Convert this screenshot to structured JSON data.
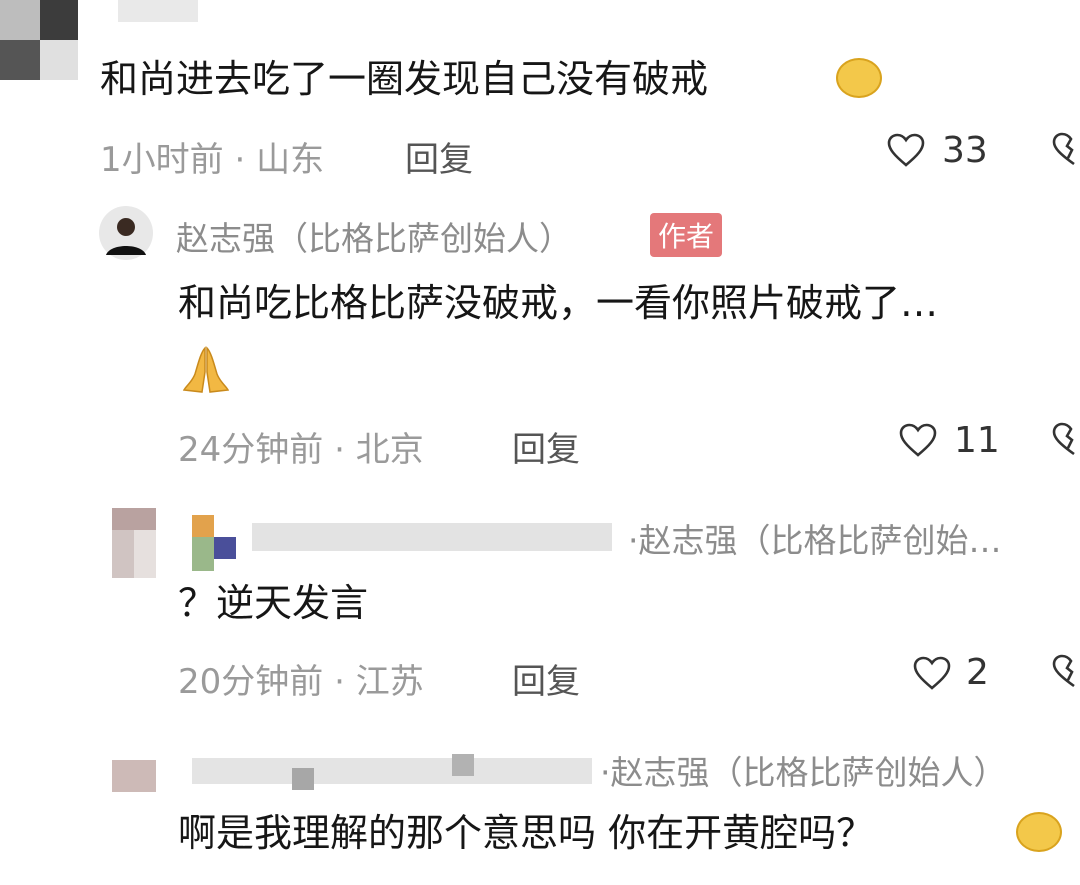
{
  "comments": [
    {
      "text": "和尚进去吃了一圈发现自己没有破戒",
      "emoji": "laughing-crying-emoji",
      "time": "1小时前",
      "location": "山东",
      "reply_label": "回复",
      "likes": "33"
    },
    {
      "author": "赵志强（比格比萨创始人）",
      "author_tag": "作者",
      "text": "和尚吃比格比萨没破戒，一看你照片破戒了…",
      "emoji": "praying-hands-emoji",
      "time": "24分钟前",
      "location": "北京",
      "reply_label": "回复",
      "likes": "11"
    },
    {
      "reply_to": "赵志强（比格比萨创始…",
      "text": "？逆天发言",
      "time": "20分钟前",
      "location": "江苏",
      "reply_label": "回复",
      "likes": "2"
    },
    {
      "reply_to": "赵志强（比格比萨创始人）",
      "text": "啊是我理解的那个意思吗 你在开黄腔吗？",
      "emoji": "laughing-crying-emoji"
    }
  ],
  "icons": {
    "like": "heart-outline-icon",
    "dislike": "broken-heart-icon"
  },
  "colors": {
    "meta_text": "#9a9a9a",
    "author_tag_bg": "#e4787a"
  }
}
